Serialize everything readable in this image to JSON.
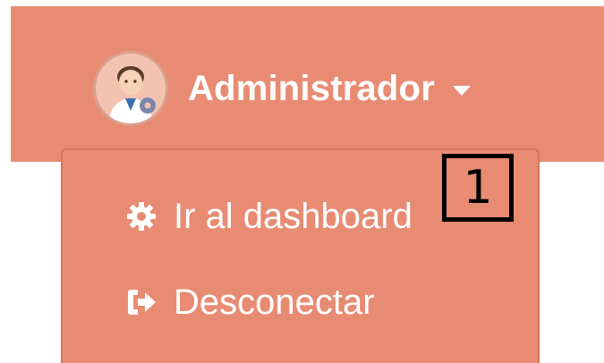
{
  "user": {
    "name": "Administrador",
    "avatar_icon": "user-avatar-icon",
    "caret_icon": "caret-down-icon"
  },
  "menu": {
    "items": [
      {
        "label": "Ir al dashboard",
        "icon": "gear-icon"
      },
      {
        "label": "Desconectar",
        "icon": "sign-out-icon"
      }
    ]
  },
  "annotation": {
    "marker_label": "1"
  },
  "colors": {
    "bar_background": "#e88b73",
    "dropdown_border": "#d9745c",
    "text": "#ffffff",
    "marker": "#000000"
  }
}
